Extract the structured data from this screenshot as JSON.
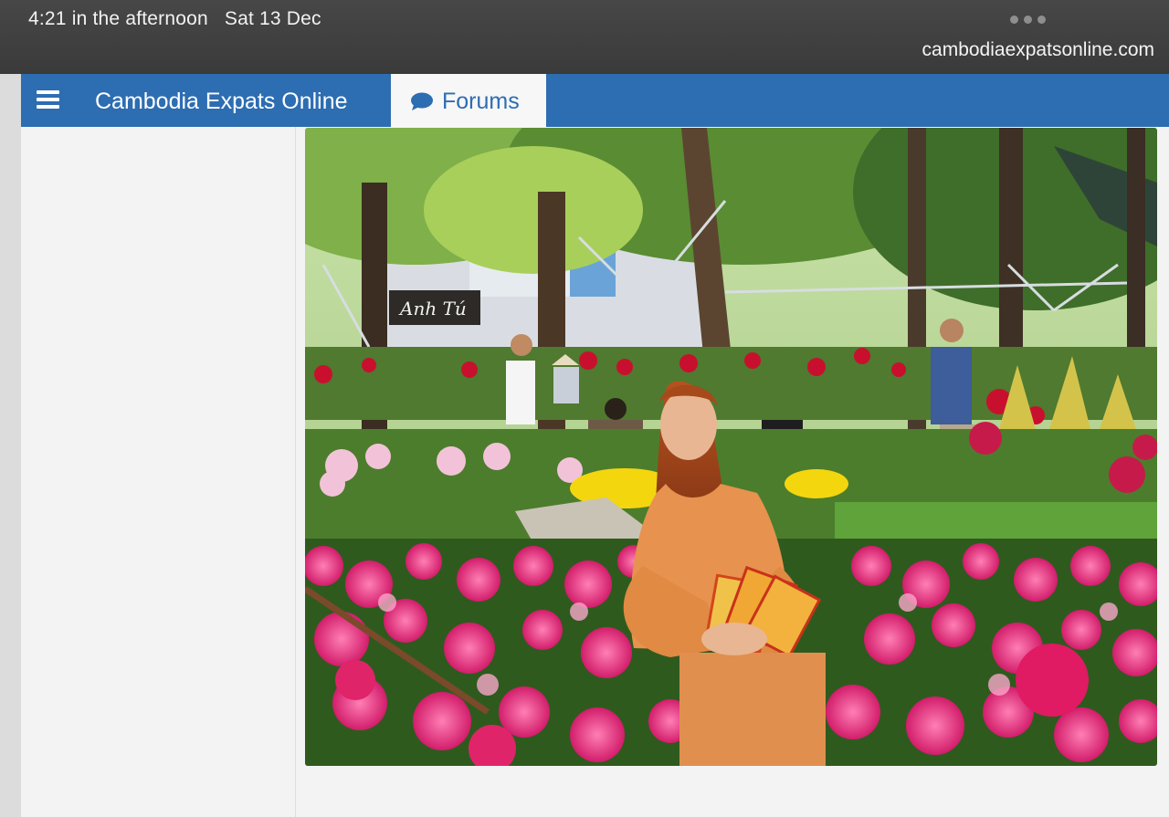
{
  "status_bar": {
    "time": "4:21 in the afternoon",
    "date": "Sat 13 Dec",
    "url": "cambodiaexpatsonline.com"
  },
  "navbar": {
    "menu_icon": "hamburger-menu-icon",
    "site_title": "Cambodia Expats Online",
    "forums_tab": {
      "icon": "speech-bubble-icon",
      "label": "Forums"
    }
  },
  "photo": {
    "sign_text": "Anh Tú"
  },
  "colors": {
    "nav_blue": "#2d6db2",
    "status_bar": "#3f3f3f",
    "panel_bg": "#f3f3f3"
  }
}
